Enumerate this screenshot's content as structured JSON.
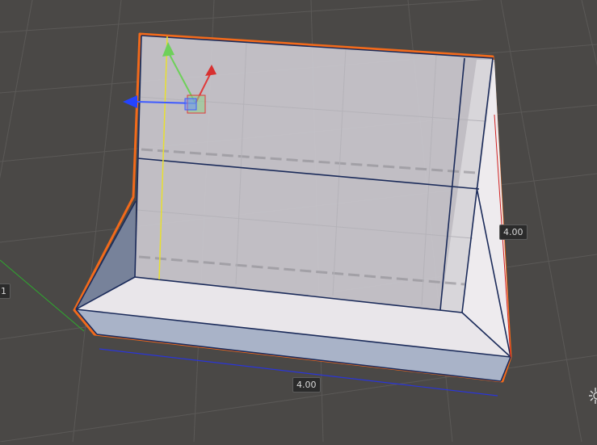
{
  "scene": {
    "dimensions": {
      "width_label": "4.00",
      "height_label": "4.00",
      "left_edge_label": "1"
    },
    "colors": {
      "background": "#4a4846",
      "grid": "#5a5856",
      "selection_outline": "#f26a1b",
      "edge_wire": "#1b2b5a",
      "axis_x": "#e03a3a",
      "axis_y": "#6ed05a",
      "axis_z": "#3f5bff",
      "world_y_line": "#e8e030",
      "world_x_ground": "#2eaa2e"
    },
    "icons": [
      "move-gizmo-icon",
      "light-sun-icon"
    ]
  }
}
